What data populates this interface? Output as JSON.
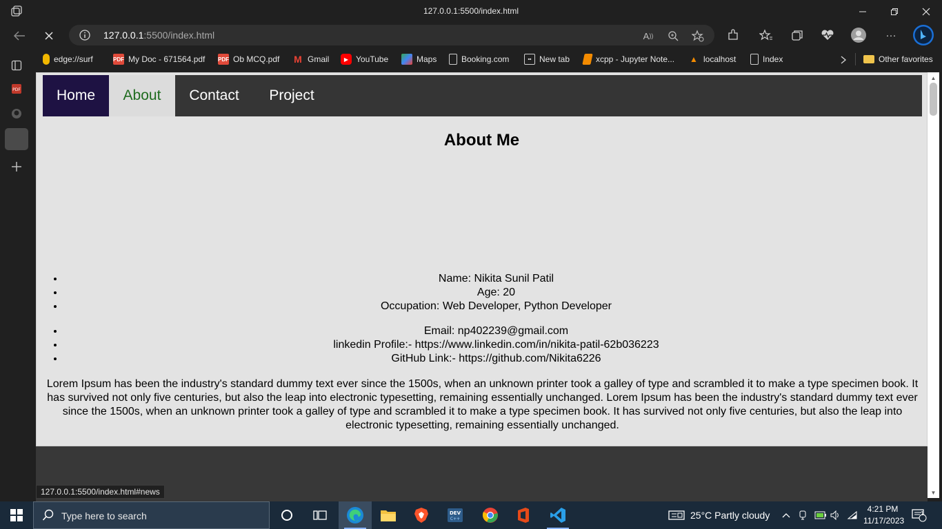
{
  "window": {
    "title": "127.0.0.1:5500/index.html"
  },
  "address_bar": {
    "url_host": "127.0.0.1",
    "url_rest": ":5500/index.html"
  },
  "favorites": [
    {
      "label": "edge://surf"
    },
    {
      "label": "My Doc - 671564.pdf"
    },
    {
      "label": "Ob MCQ.pdf"
    },
    {
      "label": "Gmail"
    },
    {
      "label": "YouTube"
    },
    {
      "label": "Maps"
    },
    {
      "label": "Booking.com"
    },
    {
      "label": "New tab"
    },
    {
      "label": "xcpp - Jupyter Note..."
    },
    {
      "label": "localhost"
    },
    {
      "label": "Index"
    }
  ],
  "other_favorites": "Other favorites",
  "site": {
    "nav": [
      "Home",
      "About",
      "Contact",
      "Project"
    ],
    "heading": "About Me",
    "details": [
      "Name: Nikita Sunil Patil",
      "Age: 20",
      "Occupation: Web Developer, Python Developer"
    ],
    "links": [
      "Email: np402239@gmail.com",
      "linkedin Profile:- https://www.linkedin.com/in/nikita-patil-62b036223",
      "GitHub Link:- https://github.com/Nikita6226"
    ],
    "paragraph": "Lorem Ipsum has been the industry's standard dummy text ever since the 1500s, when an unknown printer took a galley of type and scrambled it to make a type specimen book. It has survived not only five centuries, but also the leap into electronic typesetting, remaining essentially unchanged. Lorem Ipsum has been the industry's standard dummy text ever since the 1500s, when an unknown printer took a galley of type and scrambled it to make a type specimen book. It has survived not only five centuries, but also the leap into electronic typesetting, remaining essentially unchanged."
  },
  "status_url": "127.0.0.1:5500/index.html#news",
  "taskbar": {
    "search_placeholder": "Type here to search",
    "weather": "25°C  Partly cloudy",
    "time": "4:21 PM",
    "date": "11/17/2023",
    "notification_count": "1"
  },
  "colors": {
    "nav_bg": "#353535",
    "home_bg": "#1e1243",
    "about_bg": "#dcdcdc",
    "about_text": "#1e6b1e",
    "page_bg": "#e3e3e3"
  }
}
